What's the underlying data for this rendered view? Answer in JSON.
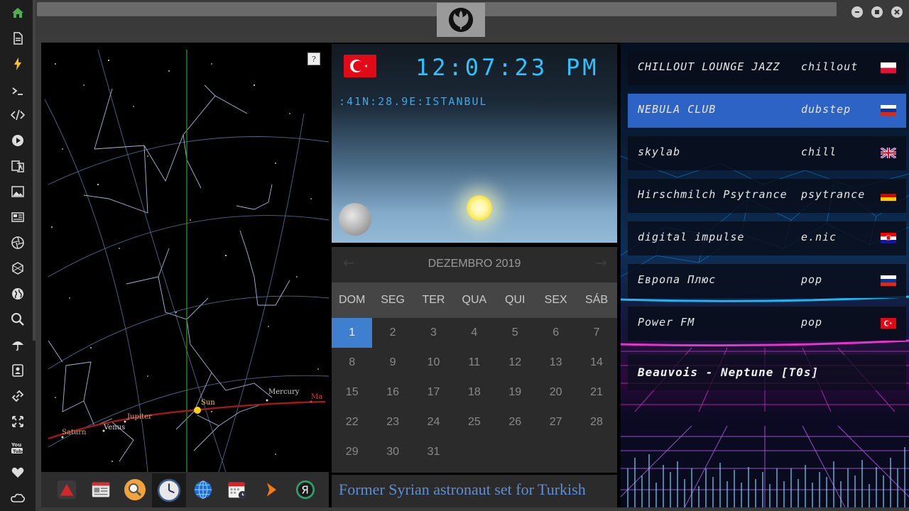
{
  "clock": {
    "time": "12:07:23",
    "ampm": "PM",
    "location": ":41N:28.9E:ISTANBUL",
    "flag_color": "#e30a17"
  },
  "skymap": {
    "help_label": "?",
    "planets": [
      {
        "label": "Saturn"
      },
      {
        "label": "Venus"
      },
      {
        "label": "Jupiter"
      },
      {
        "label": "Sun"
      },
      {
        "label": "Mercury"
      },
      {
        "label": "Ma"
      }
    ]
  },
  "calendar": {
    "month_label": "DEZEMBRO 2019",
    "prev": "←",
    "next": "→",
    "weekdays": [
      "DOM",
      "SEG",
      "TER",
      "QUA",
      "QUI",
      "SEX",
      "SÁB"
    ],
    "weeks": [
      [
        "1",
        "2",
        "3",
        "4",
        "5",
        "6",
        "7"
      ],
      [
        "8",
        "9",
        "10",
        "11",
        "12",
        "13",
        "14"
      ],
      [
        "15",
        "16",
        "17",
        "18",
        "19",
        "20",
        "21"
      ],
      [
        "22",
        "23",
        "24",
        "25",
        "26",
        "27",
        "28"
      ],
      [
        "29",
        "30",
        "31",
        "",
        "",
        "",
        ""
      ]
    ],
    "selected_day": "1",
    "accent": "#3f7fcf"
  },
  "ticker": {
    "headline": "Former Syrian astronaut set for Turkish"
  },
  "radio": {
    "stations": [
      {
        "name": "CHILLOUT LOUNGE JAZZ",
        "genre": "chillout",
        "flag": "poland"
      },
      {
        "name": "NEBULA CLUB",
        "genre": "dubstep",
        "flag": "russia"
      },
      {
        "name": "skylab",
        "genre": "chill",
        "flag": "uk"
      },
      {
        "name": "Hirschmilch Psytrance",
        "genre": "psytrance",
        "flag": "germany"
      },
      {
        "name": "digital impulse",
        "genre": "e.nic",
        "flag": "croatia"
      },
      {
        "name": "Европа Плюс",
        "genre": "pop",
        "flag": "russia"
      },
      {
        "name": "Power FM",
        "genre": "pop",
        "flag": "turkey"
      }
    ],
    "active_index": 1,
    "now_playing": "Beauvois - Neptune [T0s]",
    "active_color": "#2e63c6"
  },
  "sidebar": {
    "icons": [
      "home-icon",
      "document-icon",
      "bolt-icon",
      "terminal-icon",
      "code-icon",
      "play-icon",
      "translate-icon",
      "image-icon",
      "news-icon",
      "aperture-icon",
      "hexagon-icon",
      "globe-icon",
      "search-icon",
      "umbrella-icon",
      "contacts-icon",
      "link-icon",
      "fullscreen-icon",
      "youtube-icon",
      "heart-icon",
      "cloud-icon"
    ],
    "active_color": "#4caf50"
  },
  "dock": {
    "apps": [
      "pdf-app-icon",
      "news-app-icon",
      "search-app-icon",
      "clock-app-icon",
      "globe-app-icon",
      "calendar-app-icon",
      "play-app-icon",
      "yandex-app-icon"
    ]
  }
}
